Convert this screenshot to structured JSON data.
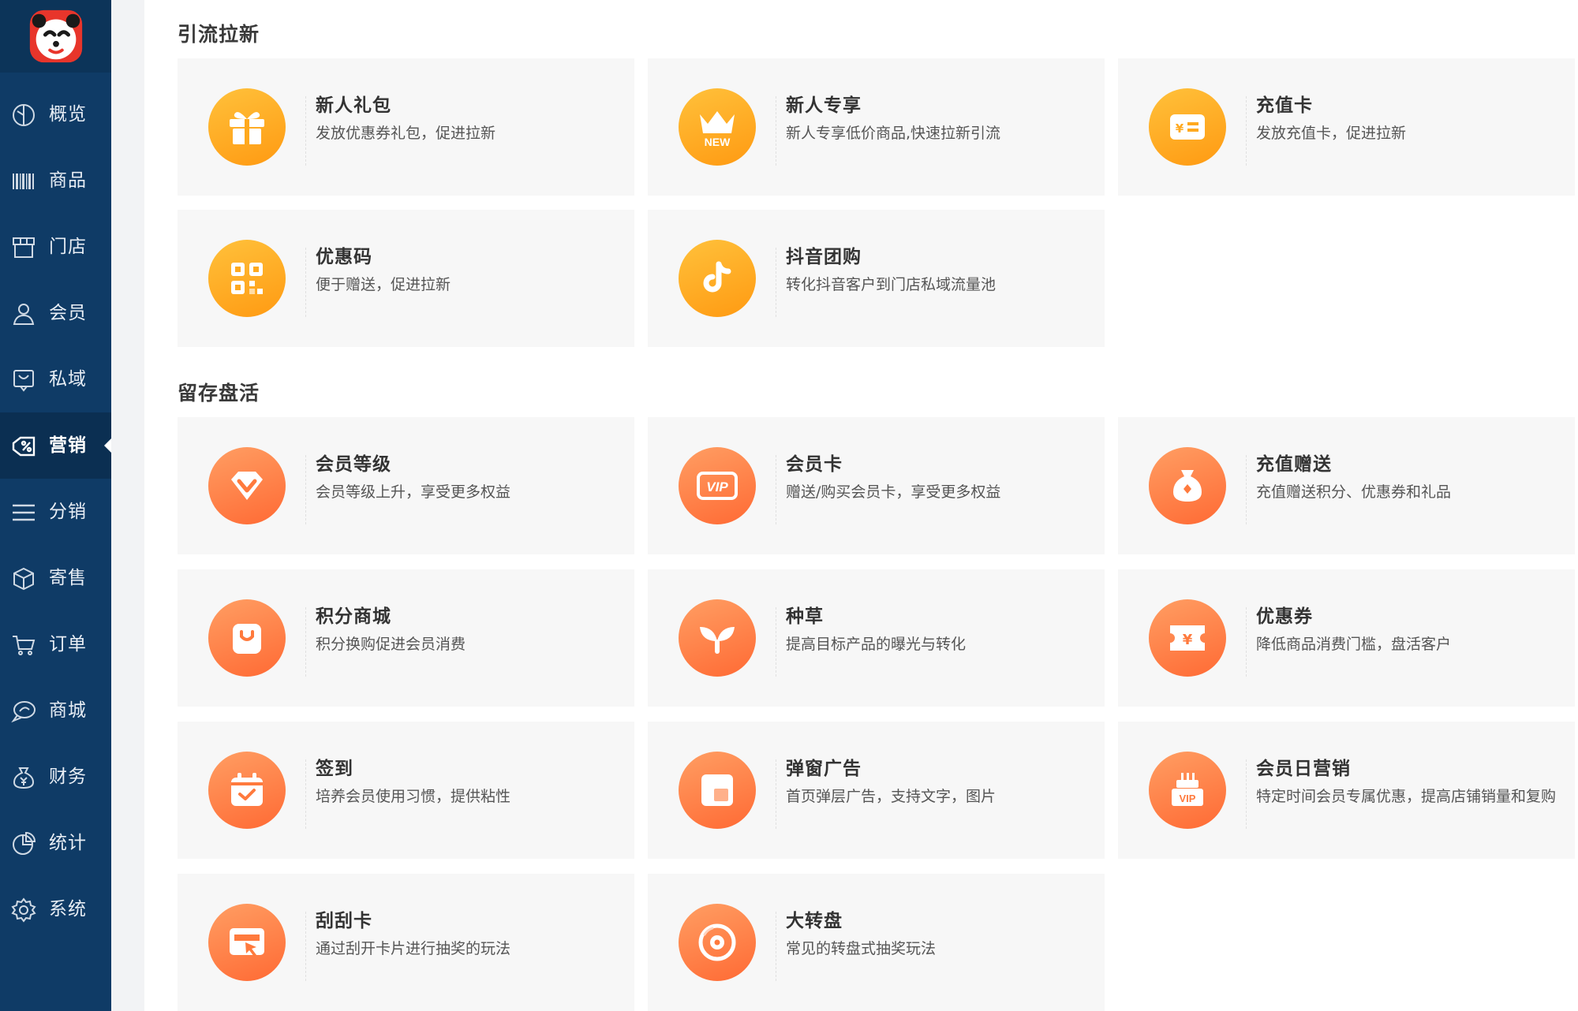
{
  "sidebar": {
    "items": [
      {
        "label": "概览",
        "icon": "dashboard-icon"
      },
      {
        "label": "商品",
        "icon": "barcode-icon"
      },
      {
        "label": "门店",
        "icon": "store-icon"
      },
      {
        "label": "会员",
        "icon": "user-icon"
      },
      {
        "label": "私域",
        "icon": "private-domain-icon"
      },
      {
        "label": "营销",
        "icon": "discount-icon",
        "active": true
      },
      {
        "label": "分销",
        "icon": "menu-icon"
      },
      {
        "label": "寄售",
        "icon": "box-icon"
      },
      {
        "label": "订单",
        "icon": "cart-icon"
      },
      {
        "label": "商城",
        "icon": "chat-icon"
      },
      {
        "label": "财务",
        "icon": "money-bag-icon"
      },
      {
        "label": "统计",
        "icon": "pie-chart-icon"
      },
      {
        "label": "系统",
        "icon": "gear-icon"
      }
    ]
  },
  "sections": [
    {
      "title": "引流拉新",
      "cards": [
        {
          "title": "新人礼包",
          "desc": "发放优惠券礼包，促进拉新",
          "icon": "gift-icon",
          "color": "#ffa91e"
        },
        {
          "title": "新人专享",
          "desc": "新人专享低价商品,快速拉新引流",
          "icon": "new-crown-icon",
          "color": "#ffa91e",
          "badge": "NEW"
        },
        {
          "title": "充值卡",
          "desc": "发放充值卡，促进拉新",
          "icon": "recharge-card-icon",
          "color": "#ffa91e"
        },
        {
          "title": "优惠码",
          "desc": "便于赠送，促进拉新",
          "icon": "qr-code-icon",
          "color": "#ffa91e"
        },
        {
          "title": "抖音团购",
          "desc": "转化抖音客户到门店私域流量池",
          "icon": "tiktok-icon",
          "color": "#ffa91e"
        }
      ]
    },
    {
      "title": "留存盘活",
      "cards": [
        {
          "title": "会员等级",
          "desc": "会员等级上升，享受更多权益",
          "icon": "diamond-icon",
          "color": "#ff7a3d"
        },
        {
          "title": "会员卡",
          "desc": "赠送/购买会员卡，享受更多权益",
          "icon": "vip-card-icon",
          "color": "#ff7a3d",
          "badge": "VIP"
        },
        {
          "title": "充值赠送",
          "desc": "充值赠送积分、优惠券和礼品",
          "icon": "money-bag-icon",
          "color": "#ff7a3d"
        },
        {
          "title": "积分商城",
          "desc": "积分换购促进会员消费",
          "icon": "shopping-bag-icon",
          "color": "#ff7a3d"
        },
        {
          "title": "种草",
          "desc": "提高目标产品的曝光与转化",
          "icon": "sprout-icon",
          "color": "#ff7a3d"
        },
        {
          "title": "优惠券",
          "desc": "降低商品消费门槛，盘活客户",
          "icon": "coupon-icon",
          "color": "#ff7a3d"
        },
        {
          "title": "签到",
          "desc": "培养会员使用习惯，提供粘性",
          "icon": "calendar-check-icon",
          "color": "#ff7a3d"
        },
        {
          "title": "弹窗广告",
          "desc": "首页弹层广告，支持文字，图片",
          "icon": "popup-ad-icon",
          "color": "#ff7a3d"
        },
        {
          "title": "会员日营销",
          "desc": "特定时间会员专属优惠，提高店铺销量和复购",
          "icon": "vip-cake-icon",
          "color": "#ff7a3d",
          "badge": "VIP"
        },
        {
          "title": "刮刮卡",
          "desc": "通过刮开卡片进行抽奖的玩法",
          "icon": "scratch-card-icon",
          "color": "#ff7a3d"
        },
        {
          "title": "大转盘",
          "desc": "常见的转盘式抽奖玩法",
          "icon": "wheel-icon",
          "color": "#ff7a3d"
        }
      ]
    }
  ]
}
